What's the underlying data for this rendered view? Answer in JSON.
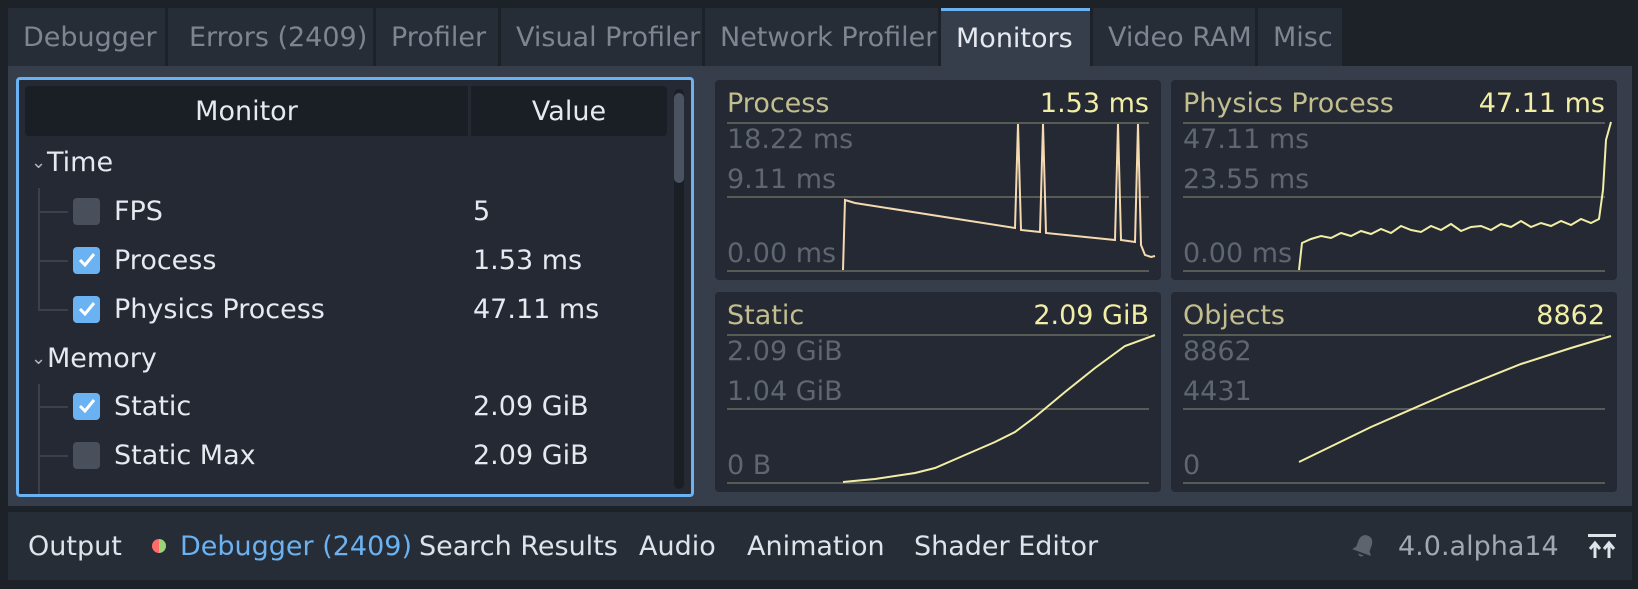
{
  "tabs": [
    {
      "label": "Debugger"
    },
    {
      "label": "Errors (2409)"
    },
    {
      "label": "Profiler"
    },
    {
      "label": "Visual Profiler"
    },
    {
      "label": "Network Profiler"
    },
    {
      "label": "Monitors"
    },
    {
      "label": "Video RAM"
    },
    {
      "label": "Misc"
    }
  ],
  "tree": {
    "header": {
      "monitor": "Monitor",
      "value": "Value"
    },
    "categories": [
      {
        "label": "Time",
        "items": [
          {
            "label": "FPS",
            "value": "5",
            "checked": false
          },
          {
            "label": "Process",
            "value": "1.53 ms",
            "checked": true
          },
          {
            "label": "Physics Process",
            "value": "47.11 ms",
            "checked": true
          }
        ]
      },
      {
        "label": "Memory",
        "items": [
          {
            "label": "Static",
            "value": "2.09 GiB",
            "checked": true
          },
          {
            "label": "Static Max",
            "value": "2.09 GiB",
            "checked": false
          }
        ]
      }
    ]
  },
  "graphs": [
    {
      "name": "Process",
      "value": "1.53 ms",
      "labels": [
        "18.22 ms",
        "9.11 ms",
        "0.00 ms"
      ]
    },
    {
      "name": "Physics Process",
      "value": "47.11 ms",
      "labels": [
        "47.11 ms",
        "23.55 ms",
        "0.00 ms"
      ]
    },
    {
      "name": "Static",
      "value": "2.09 GiB",
      "labels": [
        "2.09 GiB",
        "1.04 GiB",
        "0 B"
      ]
    },
    {
      "name": "Objects",
      "value": "8862",
      "labels": [
        "8862",
        "4431",
        "0"
      ]
    }
  ],
  "bottom": {
    "items": [
      {
        "label": "Output"
      },
      {
        "label": "Debugger (2409)"
      },
      {
        "label": "Search Results"
      },
      {
        "label": "Audio"
      },
      {
        "label": "Animation"
      },
      {
        "label": "Shader Editor"
      }
    ],
    "version": "4.0.alpha14"
  },
  "colors": {
    "accent": "#6ab2f2",
    "graph_line": "#f2eea6",
    "process_line": "#f5d9b0"
  }
}
